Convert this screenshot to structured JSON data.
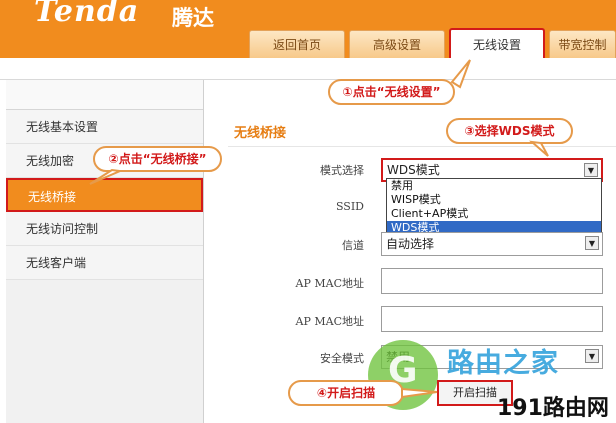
{
  "brand": {
    "logo": "Tenda",
    "name_cn": "腾达"
  },
  "tabs": [
    {
      "label": "返回首页"
    },
    {
      "label": "高级设置"
    },
    {
      "label": "无线设置",
      "active": true
    },
    {
      "label": "带宽控制"
    }
  ],
  "sidebar": {
    "items": [
      {
        "label": "无线基本设置"
      },
      {
        "label": "无线加密"
      },
      {
        "label": "无线桥接",
        "active": true
      },
      {
        "label": "无线访问控制"
      },
      {
        "label": "无线客户端"
      }
    ]
  },
  "content": {
    "title": "无线桥接",
    "mode": {
      "label": "模式选择",
      "value": "WDS模式"
    },
    "mode_options": [
      "禁用",
      "WISP模式",
      "Client+AP模式",
      "WDS模式"
    ],
    "ssid": {
      "label": "SSID"
    },
    "channel": {
      "label": "信道",
      "value": "自动选择"
    },
    "ap_mac_1": {
      "label": "AP MAC地址"
    },
    "ap_mac_2": {
      "label": "AP MAC地址"
    },
    "security": {
      "label": "安全模式",
      "value": "禁用"
    },
    "scan_button": "开启扫描"
  },
  "callouts": {
    "step1": "①点击“无线设置”",
    "step2": "②点击“无线桥接”",
    "step3": "③选择WDS模式",
    "step4": "④开启扫描"
  },
  "watermark": {
    "cn": "路由之家",
    "site": "191路由网"
  },
  "colors": {
    "brand_orange": "#f18c1e",
    "highlight_red": "#d21a1a",
    "selection_blue": "#316ac5"
  }
}
